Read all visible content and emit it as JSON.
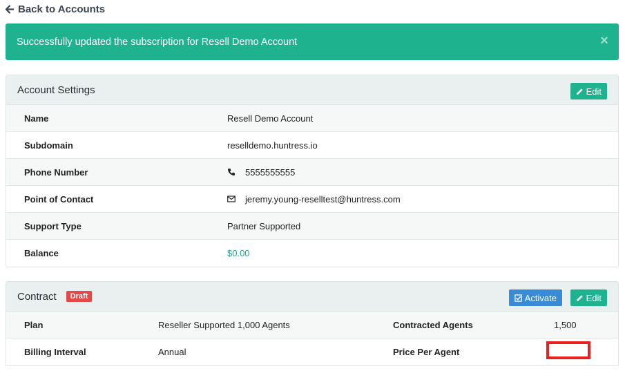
{
  "nav": {
    "back_label": "Back to Accounts"
  },
  "alert": {
    "message": "Successfully updated the subscription for Resell Demo Account",
    "close_glyph": "×"
  },
  "account_settings": {
    "title": "Account Settings",
    "edit_label": "Edit",
    "rows": [
      {
        "label": "Name",
        "value": "Resell Demo Account"
      },
      {
        "label": "Subdomain",
        "value": "reselldemo.huntress.io"
      },
      {
        "label": "Phone Number",
        "value": "5555555555",
        "icon": "phone-icon"
      },
      {
        "label": "Point of Contact",
        "value": "jeremy.young-reselltest@huntress.com",
        "icon": "envelope-icon"
      },
      {
        "label": "Support Type",
        "value": "Partner Supported"
      },
      {
        "label": "Balance",
        "value": "$0.00"
      }
    ]
  },
  "contract": {
    "title": "Contract",
    "status_badge": "Draft",
    "activate_label": "Activate",
    "edit_label": "Edit",
    "rows": [
      {
        "label": "Plan",
        "value": "Reseller Supported 1,000 Agents",
        "label2": "Contracted Agents",
        "value2": "1,500"
      },
      {
        "label": "Billing Interval",
        "value": "Annual",
        "label2": "Price Per Agent",
        "value2": ""
      }
    ]
  },
  "colors": {
    "accent": "#1fb28f",
    "primary": "#3a8bd6",
    "danger": "#e04a4a",
    "redaction": "#ea1f1f"
  }
}
